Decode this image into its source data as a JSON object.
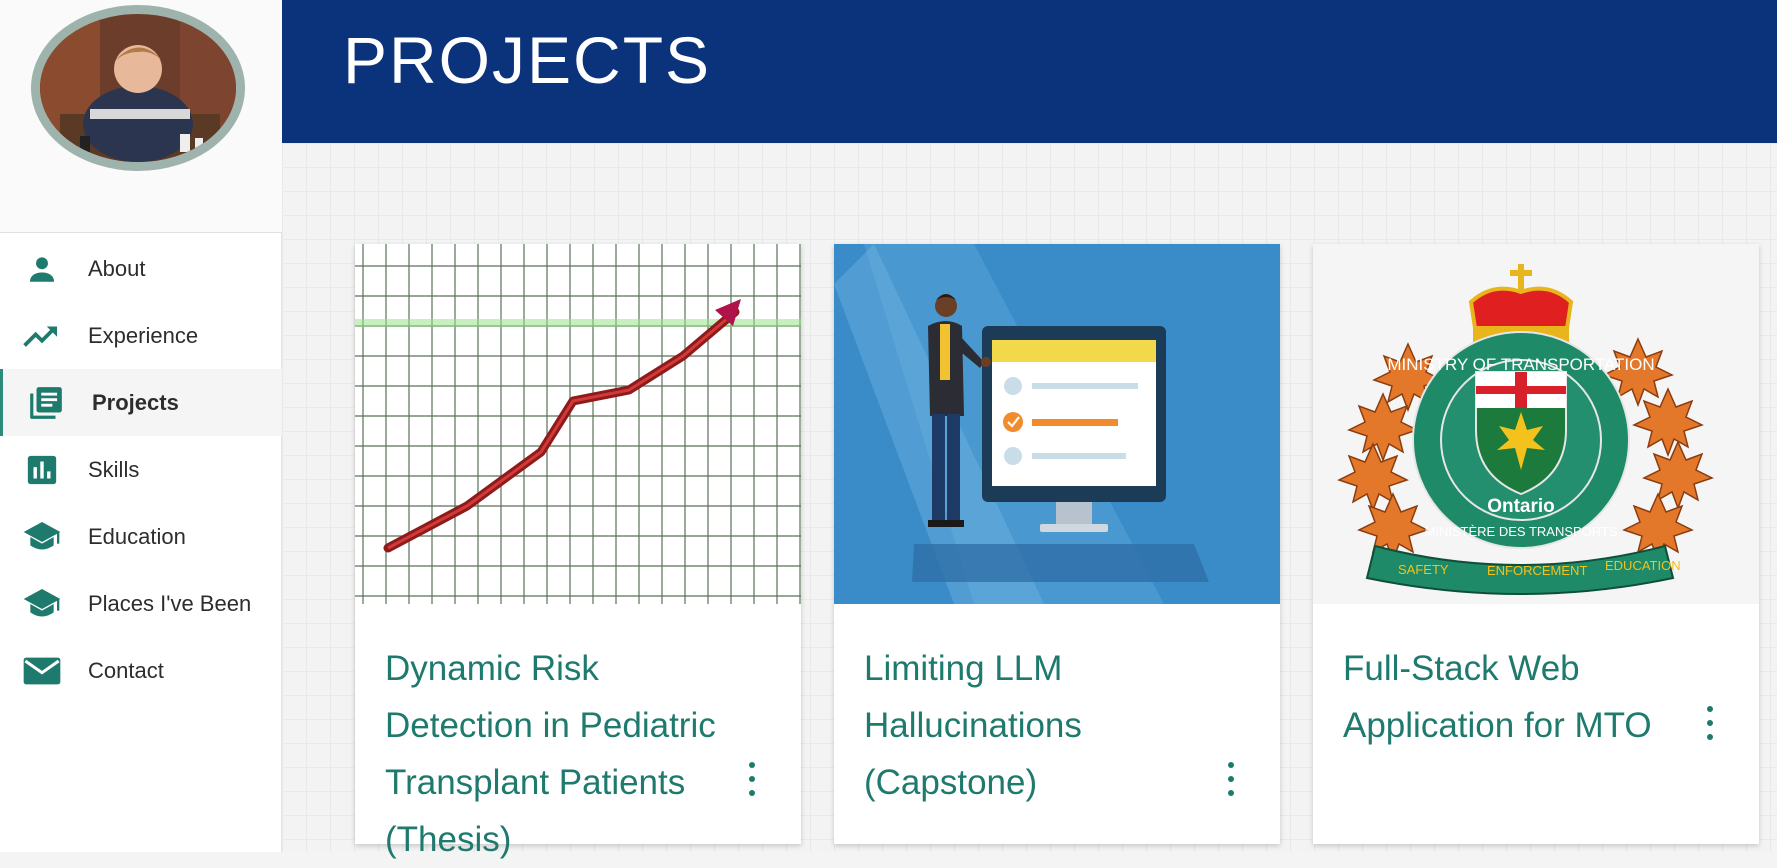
{
  "header": {
    "title": "PROJECTS"
  },
  "sidebar": {
    "items": [
      {
        "label": "About",
        "icon": "person-icon",
        "active": false
      },
      {
        "label": "Experience",
        "icon": "trending-up-icon",
        "active": false
      },
      {
        "label": "Projects",
        "icon": "library-books-icon",
        "active": true
      },
      {
        "label": "Skills",
        "icon": "bar-chart-icon",
        "active": false
      },
      {
        "label": "Education",
        "icon": "school-icon",
        "active": false
      },
      {
        "label": "Places I've Been",
        "icon": "school-icon",
        "active": false
      },
      {
        "label": "Contact",
        "icon": "mail-icon",
        "active": false
      }
    ]
  },
  "projects": [
    {
      "title": "Dynamic Risk Detection in Pediatric Transplant Patients (Thesis)",
      "image": "rising-chart-graphic"
    },
    {
      "title": "Limiting LLM Hallucinations (Capstone)",
      "image": "presenter-checklist-graphic"
    },
    {
      "title": "Full-Stack Web Application for MTO",
      "image": "mto-crest-logo"
    }
  ],
  "mto_logo": {
    "ring_top": "MINISTRY OF TRANSPORTATION",
    "ring_bottom": "MINISTÈRE DES TRANSPORTS",
    "center": "Ontario",
    "banner": [
      "SAFETY",
      "ENFORCEMENT",
      "EDUCATION"
    ]
  },
  "colors": {
    "header": "#0a337c",
    "accent": "#1f7a6e"
  }
}
